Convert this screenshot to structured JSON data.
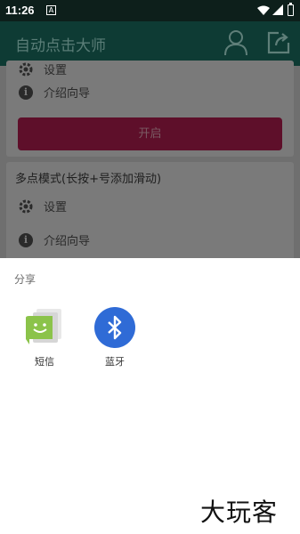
{
  "status_bar": {
    "time": "11:26",
    "notification_glyph": "A"
  },
  "app_bar": {
    "title": "自动点击大师"
  },
  "single_card": {
    "settings_label": "设置",
    "guide_label": "介绍向导",
    "start_button": "开启"
  },
  "multi_card": {
    "title": "多点模式(长按+号添加滑动)",
    "settings_label": "设置",
    "guide_label": "介绍向导"
  },
  "share_sheet": {
    "title": "分享",
    "targets": [
      {
        "label": "短信",
        "icon": "messaging-icon"
      },
      {
        "label": "蓝牙",
        "icon": "bluetooth-icon"
      }
    ]
  },
  "watermark": "大玩客",
  "colors": {
    "status_bar": "#0d1f1b",
    "app_bar": "#0e3b34",
    "scrim": "#6f6f6f",
    "start_button": "#5e0f2a",
    "bluetooth": "#2f6bd6",
    "messaging": "#8bc34a"
  }
}
